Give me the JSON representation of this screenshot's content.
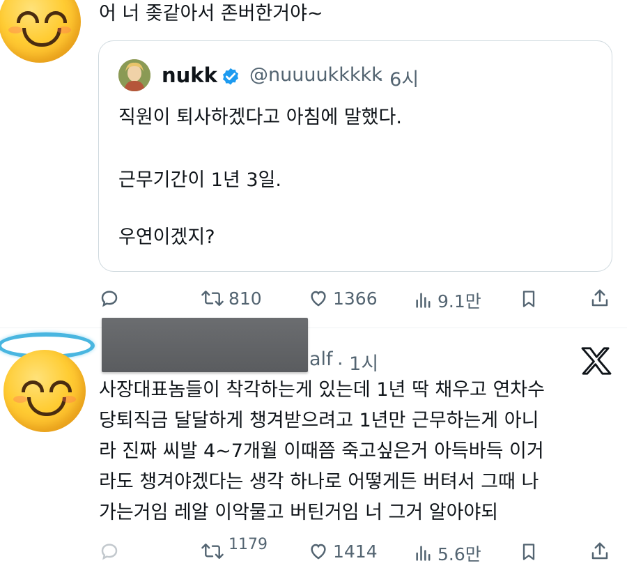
{
  "tweet1": {
    "text": "어 너 좆같아서 존버한거야~",
    "quote": {
      "display_name": "nukk",
      "handle": "@nuuuukkkkk",
      "time": "· 6시",
      "line1": "직원이 퇴사하겠다고 아침에 말했다.",
      "line2": "근무기간이 1년 3일.",
      "line3": "우연이겠지?"
    },
    "actions": {
      "retweets": "810",
      "likes": "1366",
      "views": "9.1만"
    }
  },
  "tweet2": {
    "handle_suffix": "alf",
    "time": "· 1시",
    "lines": [
      "사장대표놈들이 착각하는게 있는데 1년 딱 채우고 연차수",
      "당퇴직금 달달하게 챙겨받으려고 1년만 근무하는게 아니",
      "라 진짜 씨발 4~7개월 이때쯤 죽고싶은거 아득바득 이거",
      "라도 챙겨야겠다는 생각 하나로 어떻게든 버텨서 그때 나",
      "가는거임 레알 이악물고 버틴거임 너 그거 알아야되"
    ],
    "actions": {
      "retweets": "1179",
      "likes": "1414",
      "views": "5.6만"
    }
  },
  "icons": {
    "reply": "reply-icon",
    "retweet": "retweet-icon",
    "like": "heart-icon",
    "views": "views-icon",
    "bookmark": "bookmark-icon",
    "share": "share-icon",
    "verified": "verified-badge-icon",
    "x_logo": "x-logo-icon"
  },
  "colors": {
    "text": "#0f1419",
    "muted": "#536471",
    "verified": "#1d9bf0",
    "border": "#cfd9de"
  }
}
